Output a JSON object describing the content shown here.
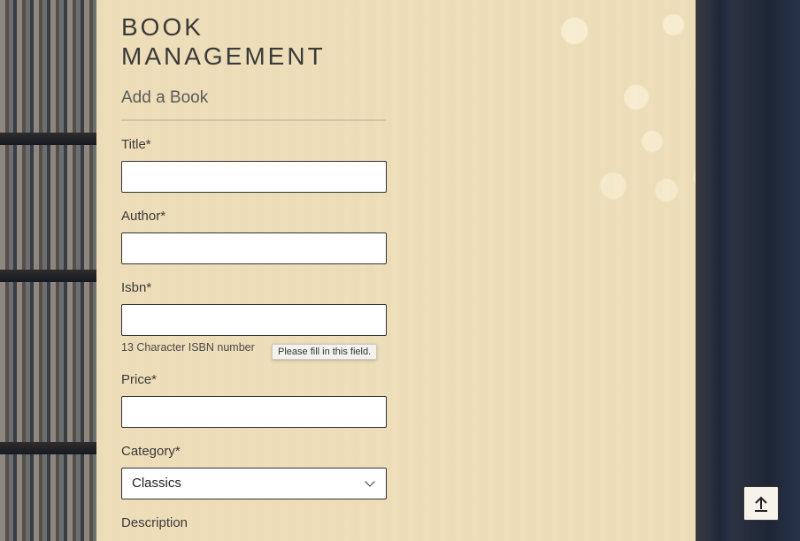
{
  "page": {
    "title": "BOOK MANAGEMENT",
    "section_title": "Add a Book"
  },
  "form": {
    "title": {
      "label": "Title*",
      "value": ""
    },
    "author": {
      "label": "Author*",
      "value": ""
    },
    "isbn": {
      "label": "Isbn*",
      "value": "",
      "helper": "13 Character ISBN number",
      "validation_tooltip": "Please fill in this field."
    },
    "price": {
      "label": "Price*",
      "value": ""
    },
    "category": {
      "label": "Category*",
      "selected": "Classics"
    },
    "description": {
      "label": "Description"
    }
  },
  "scroll_top": {
    "icon": "arrow-up-icon"
  },
  "colors": {
    "card_background": "#f1e3bf",
    "text": "#3a3a3a",
    "input_border": "#333333"
  }
}
